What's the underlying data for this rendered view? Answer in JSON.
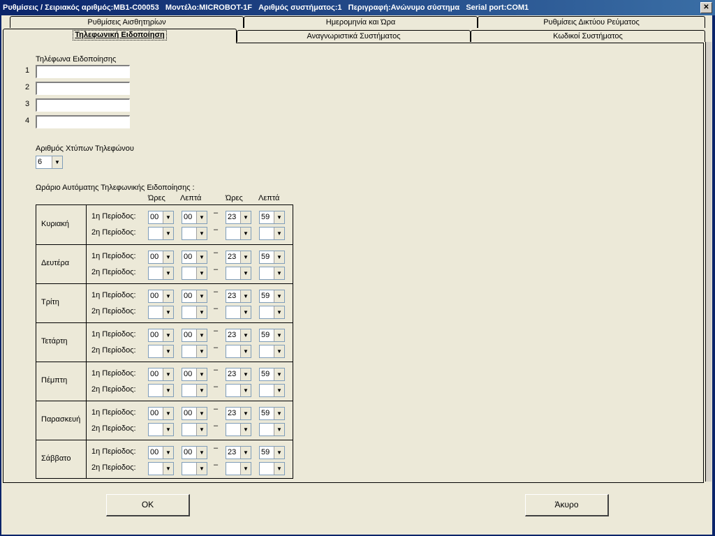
{
  "window": {
    "title": "Ρυθμίσεις / Σειριακός αριθμός:MB1-C00053   Μοντέλο:MICROBOT-1F   Αριθμός συστήματος:1   Περιγραφή:Ανώνυμο σύστημα   Serial port:COM1",
    "close_label": "✕"
  },
  "tabs_row1": [
    "Ρυθμίσεις Αισθητηρίων",
    "Ημερομηνία και Ώρα",
    "Ρυθμίσεις Δικτύου Ρεύματος"
  ],
  "tabs_row2": [
    "Τηλεφωνική Ειδοποίηση",
    "Αναγνωριστικά Συστήματος",
    "Κωδικοί Συστήματος"
  ],
  "phones": {
    "heading": "Τηλέφωνα Ειδοποίησης",
    "items": [
      {
        "index": "1",
        "value": ""
      },
      {
        "index": "2",
        "value": ""
      },
      {
        "index": "3",
        "value": ""
      },
      {
        "index": "4",
        "value": ""
      }
    ]
  },
  "rings": {
    "label": "Αριθμός Χτύπων Τηλεφώνου",
    "value": "6"
  },
  "schedule": {
    "heading": "Ωράριο Αυτόματης Τηλεφωνικής Ειδοποίησης :",
    "col_hours": "Ώρες",
    "col_minutes": "Λεπτά",
    "period1_label": "1η Περίοδος:",
    "period2_label": "2η Περίοδος:",
    "dash": "–",
    "days": [
      {
        "name": "Κυριακή",
        "p1": [
          "00",
          "00",
          "23",
          "59"
        ],
        "p2": [
          "",
          "",
          "",
          ""
        ]
      },
      {
        "name": "Δευτέρα",
        "p1": [
          "00",
          "00",
          "23",
          "59"
        ],
        "p2": [
          "",
          "",
          "",
          ""
        ]
      },
      {
        "name": "Τρίτη",
        "p1": [
          "00",
          "00",
          "23",
          "59"
        ],
        "p2": [
          "",
          "",
          "",
          ""
        ]
      },
      {
        "name": "Τετάρτη",
        "p1": [
          "00",
          "00",
          "23",
          "59"
        ],
        "p2": [
          "",
          "",
          "",
          ""
        ]
      },
      {
        "name": "Πέμπτη",
        "p1": [
          "00",
          "00",
          "23",
          "59"
        ],
        "p2": [
          "",
          "",
          "",
          ""
        ]
      },
      {
        "name": "Παρασκευή",
        "p1": [
          "00",
          "00",
          "23",
          "59"
        ],
        "p2": [
          "",
          "",
          "",
          ""
        ]
      },
      {
        "name": "Σάββατο",
        "p1": [
          "00",
          "00",
          "23",
          "59"
        ],
        "p2": [
          "",
          "",
          "",
          ""
        ]
      }
    ]
  },
  "buttons": {
    "ok": "OK",
    "cancel": "Άκυρο"
  }
}
